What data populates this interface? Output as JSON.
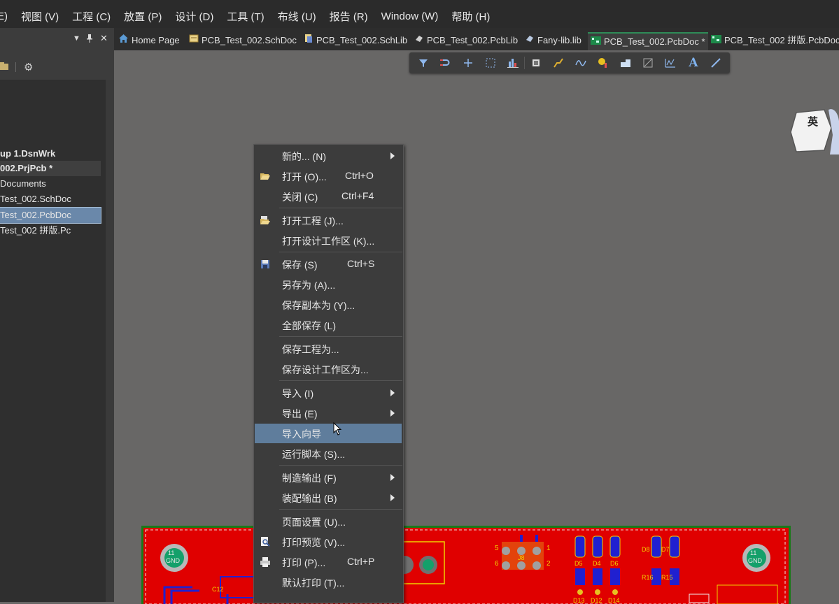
{
  "menubar": {
    "items": [
      "E) ",
      "视图 (V)",
      "工程 (C)",
      "放置 (P)",
      "设计 (D)",
      "工具 (T)",
      "布线 (U)",
      "报告 (R)",
      "Window (W)",
      "帮助 (H)"
    ]
  },
  "left_panel": {
    "tree": [
      {
        "label": "up 1.DsnWrk"
      },
      {
        "label": "002.PrjPcb *"
      },
      {
        "label": "Documents"
      },
      {
        "label": "Test_002.SchDoc"
      },
      {
        "label": "Test_002.PcbDoc"
      },
      {
        "label": "Test_002 拼版.Pc"
      }
    ]
  },
  "tabs": [
    {
      "label": "Home Page",
      "icon": "home-icon"
    },
    {
      "label": "PCB_Test_002.SchDoc",
      "icon": "schematic-icon"
    },
    {
      "label": "PCB_Test_002.SchLib",
      "icon": "schlib-icon"
    },
    {
      "label": "PCB_Test_002.PcbLib",
      "icon": "pcblib-icon"
    },
    {
      "label": "Fany-lib.lib",
      "icon": "lib-icon"
    },
    {
      "label": "PCB_Test_002.PcbDoc *",
      "icon": "pcb-icon"
    },
    {
      "label": "PCB_Test_002 拼版.PcbDoc",
      "icon": "pcb-icon"
    }
  ],
  "toolbar": {
    "icons": [
      "filter-icon",
      "route-icon",
      "add-icon",
      "select-rect-icon",
      "align-icon",
      "component-icon",
      "track-icon",
      "interactive-route-icon",
      "pad-icon",
      "polygon-icon",
      "region-icon",
      "dimension-icon",
      "text-icon",
      "line-icon"
    ]
  },
  "ime": {
    "label": "英"
  },
  "context_menu": {
    "items": [
      {
        "label": "新的... (N)",
        "shortcut": "",
        "submenu": true
      },
      {
        "label": "打开 (O)...",
        "shortcut": "Ctrl+O",
        "icon": "open-folder-icon"
      },
      {
        "label": "关闭 (C)",
        "shortcut": "Ctrl+F4"
      },
      {
        "label": "打开工程 (J)...",
        "shortcut": "",
        "icon": "open-project-icon"
      },
      {
        "label": "打开设计工作区 (K)...",
        "shortcut": ""
      },
      {
        "label": "保存 (S)",
        "shortcut": "Ctrl+S",
        "icon": "save-icon"
      },
      {
        "label": "另存为 (A)...",
        "shortcut": ""
      },
      {
        "label": "保存副本为 (Y)...",
        "shortcut": ""
      },
      {
        "label": "全部保存 (L)",
        "shortcut": ""
      },
      {
        "label": "保存工程为...",
        "shortcut": ""
      },
      {
        "label": "保存设计工作区为...",
        "shortcut": ""
      },
      {
        "label": "导入 (I)",
        "shortcut": "",
        "submenu": true
      },
      {
        "label": "导出 (E)",
        "shortcut": "",
        "submenu": true
      },
      {
        "label": "导入向导",
        "shortcut": "",
        "highlighted": true
      },
      {
        "label": "运行脚本 (S)...",
        "shortcut": ""
      },
      {
        "label": "制造输出 (F)",
        "shortcut": "",
        "submenu": true
      },
      {
        "label": "装配输出 (B)",
        "shortcut": "",
        "submenu": true
      },
      {
        "label": "页面设置 (U)...",
        "shortcut": ""
      },
      {
        "label": "打印预览 (V)...",
        "shortcut": "",
        "icon": "print-preview-icon"
      },
      {
        "label": "打印 (P)...",
        "shortcut": "Ctrl+P",
        "icon": "printer-icon"
      },
      {
        "label": "默认打印 (T)...",
        "shortcut": ""
      }
    ]
  },
  "pcb": {
    "labels": [
      "11",
      "GND",
      "11",
      "GND",
      "C12",
      "J8",
      "D5",
      "D4",
      "D6",
      "D8",
      "D7",
      "R16",
      "R15",
      "D13",
      "D12",
      "D14",
      "5",
      "6",
      "1",
      "2"
    ]
  },
  "colors": {
    "board": "#e00000",
    "outline": "#1a7a1a",
    "highlight": "#5f7d9c"
  }
}
